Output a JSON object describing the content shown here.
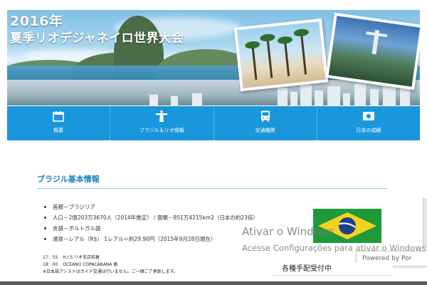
{
  "hero": {
    "title_line1": "2016年",
    "title_line2": "夏季リオデジャネイロ世界大会"
  },
  "nav": {
    "items": [
      {
        "label": "概要",
        "icon": "calendar-icon"
      },
      {
        "label": "ブラジル＆リオ情報",
        "icon": "christ-statue-icon"
      },
      {
        "label": "交通機関",
        "icon": "bus-icon"
      },
      {
        "label": "日本の成績",
        "icon": "japan-flag-icon"
      }
    ]
  },
  "section": {
    "title": "ブラジル基本情報",
    "items": [
      "首都－ブラジリア",
      "人口－2億203万3670人（2014年推定） / 面積－851万4215km2（日本の約23倍）",
      "言語－ポルトガル語",
      "通貨－レアル（R$） 1レアル＝約29.90円（2015年9月28日現在）"
    ]
  },
  "schedule": {
    "rows": [
      {
        "time": "17：55",
        "text": "H.I.S.リオ支店前着"
      },
      {
        "time": "18：00",
        "text": "OCEANO COPACABANA 着"
      }
    ],
    "note": "※日本語アシストはガイド交通は行いません。ご一緒ご了承致します。"
  },
  "reception": {
    "label": "各種手配受付中"
  },
  "watermark": {
    "title": "Ativar o Windows",
    "subtitle": "Acesse Configurações para ativar o Windows."
  },
  "powered": {
    "label": "Powered by Por"
  },
  "colors": {
    "nav_blue": "#1a96dc",
    "title_blue": "#1a7fc1",
    "flag_green": "#1f9a3a",
    "flag_yellow": "#f4d31f",
    "flag_blue": "#1d3f8f"
  }
}
